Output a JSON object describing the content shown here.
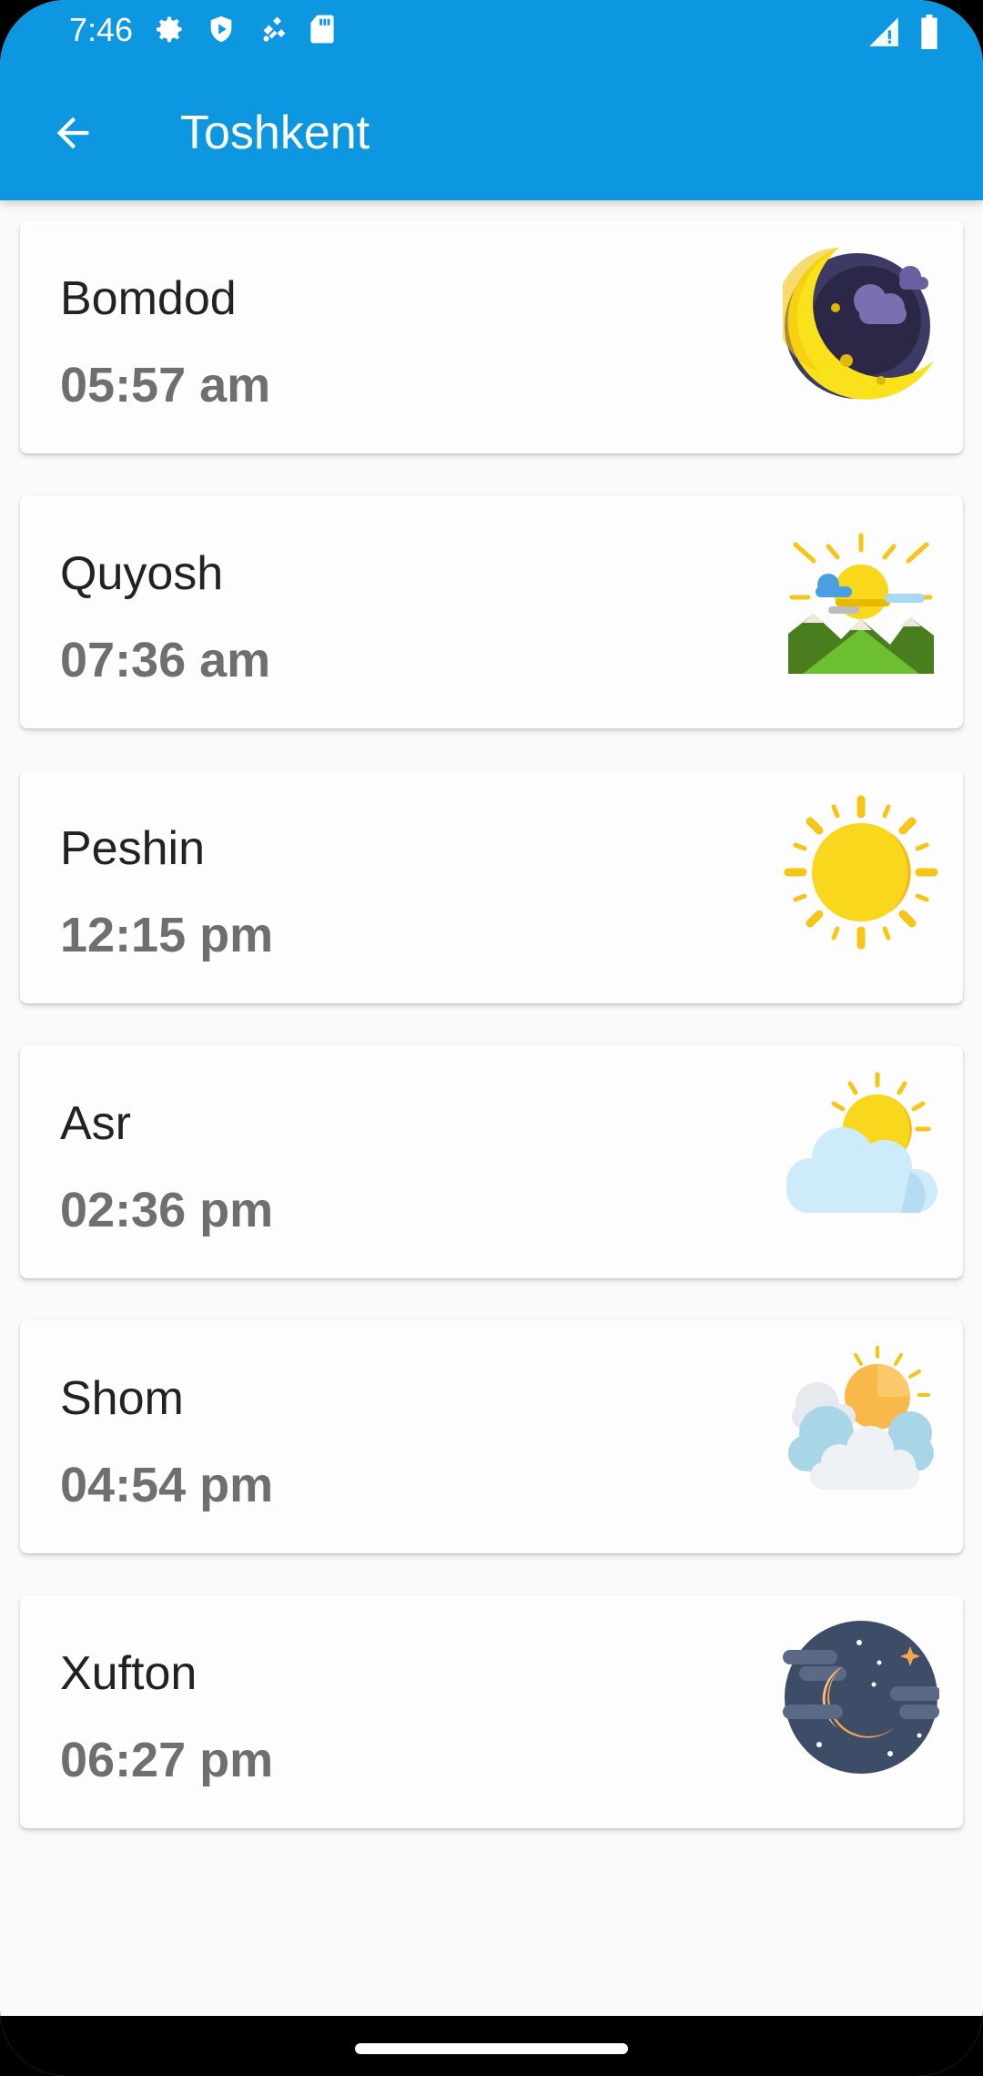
{
  "status_bar": {
    "time": "7:46",
    "left_icons": [
      "settings-icon",
      "shield-play-icon",
      "satellite-icon",
      "sd-card-icon"
    ],
    "right_icons": [
      "signal-icon",
      "battery-icon"
    ]
  },
  "toolbar": {
    "back_icon": "arrow-back-icon",
    "title": "Toshkent"
  },
  "prayers": [
    {
      "name": "Bomdod",
      "time": "05:57 am",
      "icon": "crescent-moon-cloud-icon"
    },
    {
      "name": "Quyosh",
      "time": "07:36 am",
      "icon": "sunrise-mountains-icon"
    },
    {
      "name": "Peshin",
      "time": "12:15 pm",
      "icon": "sun-icon"
    },
    {
      "name": "Asr",
      "time": "02:36 pm",
      "icon": "sun-behind-cloud-icon"
    },
    {
      "name": "Shom",
      "time": "04:54 pm",
      "icon": "sunset-clouds-icon"
    },
    {
      "name": "Xufton",
      "time": "06:27 pm",
      "icon": "night-moon-stars-icon"
    }
  ],
  "colors": {
    "app_bar": "#0d97e0",
    "card": "#fdfdfd",
    "name_text": "#222222",
    "time_text": "#6f6f6f"
  }
}
